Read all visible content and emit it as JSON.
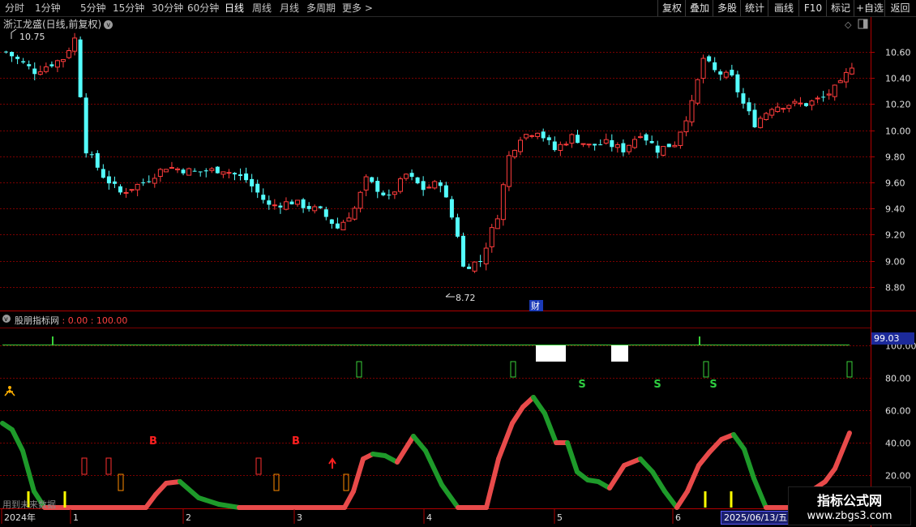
{
  "toolbar": {
    "timeframes": [
      "分时",
      "1分钟",
      "5分钟",
      "15分钟",
      "30分钟",
      "60分钟",
      "日线",
      "周线",
      "月线",
      "多周期",
      "更多 >"
    ],
    "right_buttons": [
      "复权",
      "叠加",
      "多股",
      "统计",
      "画线",
      "F10",
      "标记",
      "+自选",
      "返回"
    ]
  },
  "main_chart": {
    "title": "浙江龙盛(日线,前复权)",
    "y_ticks": [
      "10.60",
      "10.40",
      "10.20",
      "10.00",
      "9.80",
      "9.60",
      "9.40",
      "9.20",
      "9.00",
      "8.80"
    ],
    "high_label": "10.75",
    "low_label": "8.72",
    "cai_label": "财",
    "colors": {
      "up": "#ff3c3c",
      "down": "#54ffff",
      "grid": "#7a0000"
    }
  },
  "indicator": {
    "name": "股朋指标网",
    "values": ": 0.00 : 100.00",
    "current_value": "99.03",
    "y_ticks": [
      "100.00",
      "80.00",
      "60.00",
      "40.00",
      "20.00"
    ],
    "b_labels": [
      "B",
      "B"
    ],
    "s_labels": [
      "S",
      "S",
      "S"
    ],
    "note": "用到未来数据",
    "colors": {
      "rising": "#e84a4a",
      "falling": "#1e9a2a"
    }
  },
  "x_axis": {
    "labels": [
      "2024年",
      "1",
      "2",
      "3",
      "4",
      "5",
      "6"
    ],
    "selected_date": "2025/06/13/五"
  },
  "watermark": {
    "title": "指标公式网",
    "url": "www.zbgs3.com"
  }
}
